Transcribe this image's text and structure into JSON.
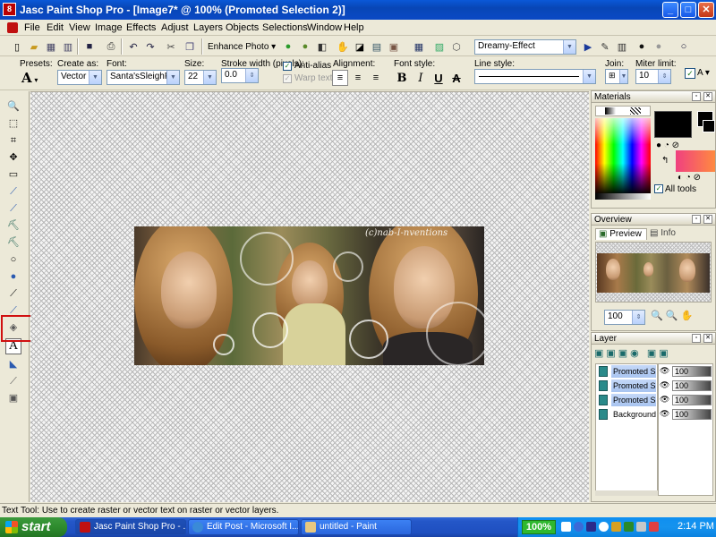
{
  "window": {
    "app_icon": "8",
    "title": "Jasc Paint Shop Pro - [Image7* @ 100% (Promoted Selection 2)]",
    "min": "_",
    "max": "□",
    "close": "✕"
  },
  "menu": [
    "File",
    "Edit",
    "View",
    "Image",
    "Effects",
    "Adjust",
    "Layers",
    "Objects",
    "Selections",
    "Window",
    "Help"
  ],
  "toolbar": {
    "enhance_photo": "Enhance Photo",
    "preset_effect": "Dreamy-Effect"
  },
  "tool_options": {
    "presets_label": "Presets:",
    "create_as_label": "Create as:",
    "create_as_value": "Vector",
    "font_label": "Font:",
    "font_value": "Santa'sSleighFull",
    "size_label": "Size:",
    "size_value": "22",
    "stroke_label": "Stroke width (pixels):",
    "stroke_value": "0.0",
    "antialias_label": "Anti-alias",
    "warp_label": "Warp text",
    "alignment_label": "Alignment:",
    "font_style_label": "Font style:",
    "line_style_label": "Line style:",
    "join_label": "Join:",
    "miter_label": "Miter limit:",
    "miter_value": "10",
    "bold": "B",
    "italic": "I",
    "underline": "U",
    "strike": "A"
  },
  "image": {
    "watermark": "(c)nab-I-nventions"
  },
  "materials": {
    "title": "Materials",
    "all_tools": "All tools"
  },
  "overview": {
    "title": "Overview",
    "tab_preview": "Preview",
    "tab_info": "Info",
    "zoom_value": "100"
  },
  "layers": {
    "title": "Layer",
    "rows": [
      {
        "name": "Promoted S",
        "opacity": "100"
      },
      {
        "name": "Promoted S",
        "opacity": "100"
      },
      {
        "name": "Promoted S",
        "opacity": "100"
      },
      {
        "name": "Background",
        "opacity": "100"
      }
    ]
  },
  "status": "Text Tool: Use to create raster or vector text on raster or vector layers.",
  "taskbar": {
    "start": "start",
    "tasks": [
      "Jasc Paint Shop Pro - ...",
      "Edit Post - Microsoft I...",
      "untitled - Paint"
    ],
    "battery": "100%",
    "clock": "2:14 PM"
  },
  "colors": {
    "title_bar": "#0a58d8",
    "taskbar": "#2457c8",
    "start": "#2e8b2e",
    "highlight": "#d01010"
  }
}
